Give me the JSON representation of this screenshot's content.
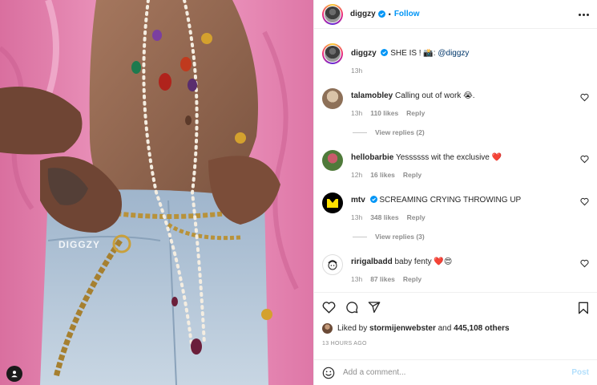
{
  "post": {
    "author": "diggzy",
    "follow_label": "Follow",
    "dot": "•",
    "watermark": "DIGGZY"
  },
  "caption": {
    "username": "diggzy",
    "text": "SHE IS ! 📸: ",
    "mention": "@diggzy",
    "time": "13h"
  },
  "comments": [
    {
      "username": "talamobley",
      "text": "Calling out of work 😭.",
      "time": "13h",
      "likes": "110 likes",
      "reply": "Reply",
      "view_replies": "View replies (2)"
    },
    {
      "username": "hellobarbie",
      "text": "Yessssss wit the exclusive ❤️",
      "time": "12h",
      "likes": "16 likes",
      "reply": "Reply",
      "view_replies": ""
    },
    {
      "username": "mtv",
      "text": "SCREAMING CRYING THROWING UP",
      "time": "13h",
      "likes": "348 likes",
      "reply": "Reply",
      "view_replies": "View replies (3)"
    },
    {
      "username": "ririgalbadd",
      "text": "baby fenty ❤️😍",
      "time": "13h",
      "likes": "87 likes",
      "reply": "Reply",
      "view_replies": ""
    }
  ],
  "likes": {
    "prefix": "Liked by ",
    "user": "stormijenwebster",
    "middle": " and ",
    "count": "445,108 others"
  },
  "timestamp": "13 HOURS AGO",
  "add_comment": {
    "placeholder": "Add a comment...",
    "post_label": "Post"
  },
  "icons": [
    "verified-badge-icon",
    "more-options-icon",
    "heart-icon",
    "comment-icon",
    "share-icon",
    "bookmark-icon",
    "emoji-icon",
    "user-tag-icon"
  ],
  "colors": {
    "link": "#0095f6",
    "mention": "#00376b",
    "muted": "#8e8e8e",
    "post_disabled": "#b2dffc",
    "jacket_pink": "#e98db5"
  }
}
